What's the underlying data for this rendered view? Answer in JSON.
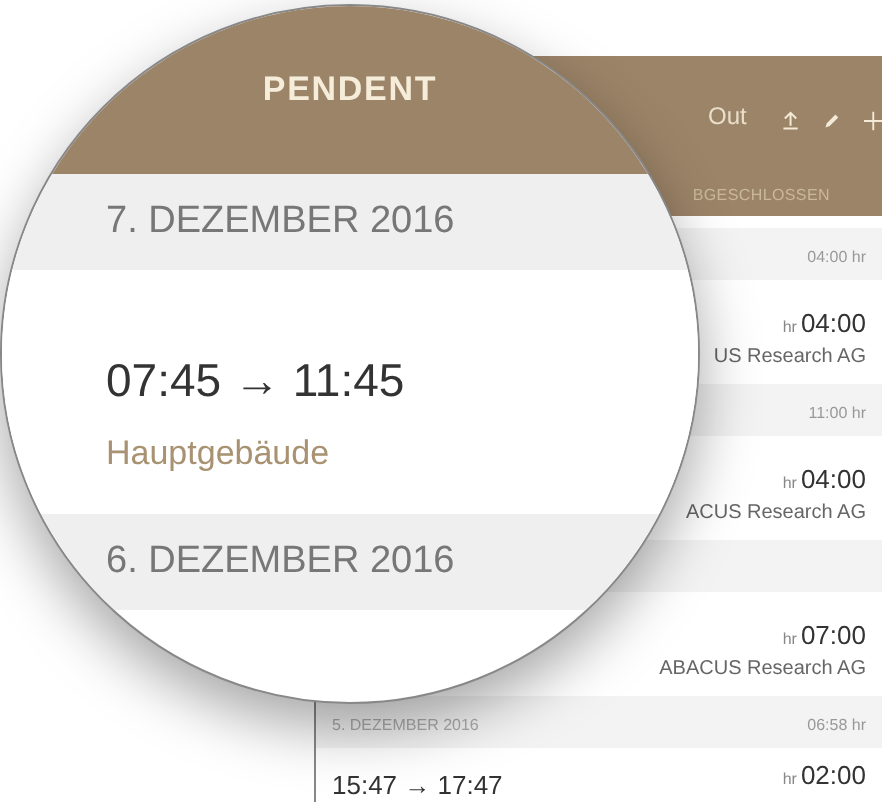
{
  "app_panel": {
    "toolbar": {
      "button_label": "Out"
    },
    "tab_label": "BGESCHLOSSEN",
    "rows": [
      {
        "kind": "summary",
        "total": "04:00 hr"
      },
      {
        "kind": "entry",
        "unit": "hr",
        "duration": "04:00",
        "client": "US Research AG"
      },
      {
        "kind": "summary",
        "total": "11:00 hr"
      },
      {
        "kind": "entry",
        "unit": "hr",
        "duration": "04:00",
        "client": "ACUS Research AG"
      },
      {
        "kind": "summary"
      },
      {
        "kind": "entry",
        "unit": "hr",
        "duration": "07:00",
        "client": "ABACUS Research AG"
      },
      {
        "kind": "summary",
        "date": "5. DEZEMBER 2016",
        "total": "06:58 hr"
      },
      {
        "kind": "entry",
        "times": "15:47 → 17:47",
        "unit": "hr",
        "duration": "02:00"
      }
    ]
  },
  "magnifier": {
    "title": "PENDENT",
    "rows": [
      {
        "kind": "date",
        "text": "7. DEZEMBER 2016"
      },
      {
        "kind": "entry",
        "times": "07:45 → 11:45",
        "location": "Hauptgebäude"
      },
      {
        "kind": "date",
        "text": "6. DEZEMBER 2016"
      }
    ]
  }
}
